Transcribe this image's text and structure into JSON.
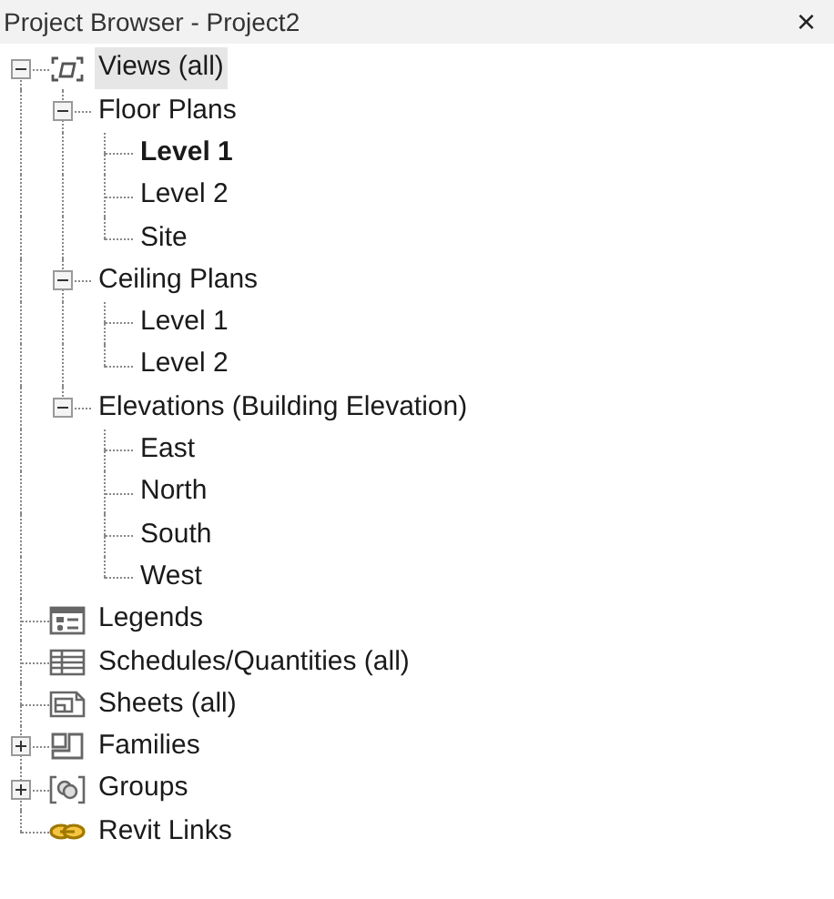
{
  "panel": {
    "title": "Project Browser - Project2",
    "close": "×"
  },
  "tree": [
    {
      "kind": "views",
      "label": "Views (all)",
      "selected": true,
      "bold": false,
      "expanded": true,
      "children": [
        {
          "label": "Floor Plans",
          "selected": false,
          "bold": false,
          "expanded": true,
          "children": [
            {
              "label": "Level 1",
              "selected": false,
              "bold": true
            },
            {
              "label": "Level 2",
              "selected": false,
              "bold": false
            },
            {
              "label": "Site",
              "selected": false,
              "bold": false
            }
          ]
        },
        {
          "label": "Ceiling Plans",
          "selected": false,
          "bold": false,
          "expanded": true,
          "children": [
            {
              "label": "Level 1",
              "selected": false,
              "bold": false
            },
            {
              "label": "Level 2",
              "selected": false,
              "bold": false
            }
          ]
        },
        {
          "label": "Elevations (Building Elevation)",
          "selected": false,
          "bold": false,
          "expanded": true,
          "children": [
            {
              "label": "East",
              "selected": false,
              "bold": false
            },
            {
              "label": "North",
              "selected": false,
              "bold": false
            },
            {
              "label": "South",
              "selected": false,
              "bold": false
            },
            {
              "label": "West",
              "selected": false,
              "bold": false
            }
          ]
        }
      ]
    },
    {
      "kind": "legends",
      "label": "Legends",
      "selected": false,
      "bold": false
    },
    {
      "kind": "schedules",
      "label": "Schedules/Quantities (all)",
      "selected": false,
      "bold": false
    },
    {
      "kind": "sheets",
      "label": "Sheets (all)",
      "selected": false,
      "bold": false
    },
    {
      "kind": "families",
      "label": "Families",
      "selected": false,
      "bold": false,
      "expanded": false
    },
    {
      "kind": "groups",
      "label": "Groups",
      "selected": false,
      "bold": false,
      "expanded": false
    },
    {
      "kind": "links",
      "label": "Revit Links",
      "selected": false,
      "bold": false
    }
  ]
}
